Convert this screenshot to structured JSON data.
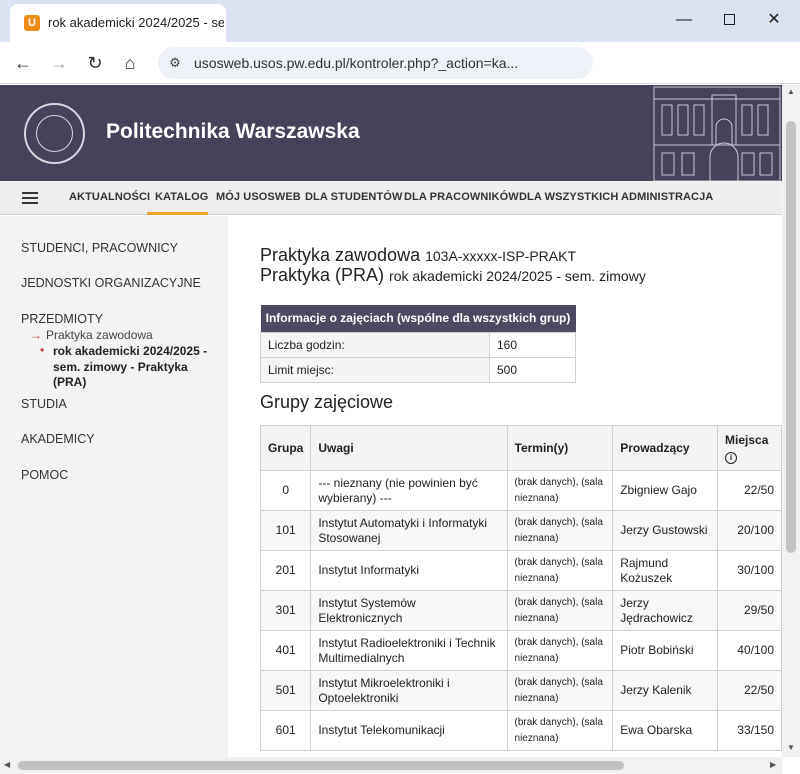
{
  "browser": {
    "tab_title": "rok akademicki 2024/2025 - sem",
    "favicon_letter": "U",
    "url": "usosweb.usos.pw.edu.pl/kontroler.php?_action=ka..."
  },
  "banner": {
    "university": "Politechnika Warszawska"
  },
  "menu": {
    "items": [
      "AKTUALNOŚCI",
      "KATALOG",
      "MÓJ USOSWEB",
      "DLA STUDENTÓW",
      "DLA PRACOWNIKÓW",
      "DLA WSZYSTKICH",
      "ADMINISTRACJA"
    ],
    "active": "KATALOG"
  },
  "sidebar": {
    "items": [
      "STUDENCI, PRACOWNICY",
      "JEDNOSTKI ORGANIZACYJNE",
      "PRZEDMIOTY",
      "STUDIA",
      "AKADEMICY",
      "POMOC"
    ],
    "sub_item": "Praktyka zawodowa",
    "current": "rok akademicki 2024/2025 - sem. zimowy - Praktyka (PRA)"
  },
  "course": {
    "name": "Praktyka zawodowa",
    "code": "103A-xxxxx-ISP-PRAKT",
    "class_type": "Praktyka (PRA)",
    "term": "rok akademicki 2024/2025 - sem. zimowy"
  },
  "info_table": {
    "header": "Informacje o zajęciach (wspólne dla wszystkich grup)",
    "rows": [
      {
        "label": "Liczba godzin:",
        "value": "160"
      },
      {
        "label": "Limit miejsc:",
        "value": "500"
      }
    ]
  },
  "groups": {
    "title": "Grupy zajęciowe",
    "columns": [
      "Grupa",
      "Uwagi",
      "Termin(y)",
      "Prowadzący",
      "Miejsca"
    ],
    "rows": [
      {
        "group": "0",
        "note": "--- nieznany (nie powinien być wybierany) ---",
        "term": "(brak danych), (sala nieznana)",
        "teacher": "Zbigniew Gajo",
        "seats": "22/50"
      },
      {
        "group": "101",
        "note": "Instytut Automatyki i Informatyki Stosowanej",
        "term": "(brak danych), (sala nieznana)",
        "teacher": "Jerzy Gustowski",
        "seats": "20/100"
      },
      {
        "group": "201",
        "note": "Instytut Informatyki",
        "term": "(brak danych), (sala nieznana)",
        "teacher": "Rajmund Kożuszek",
        "seats": "30/100"
      },
      {
        "group": "301",
        "note": "Instytut Systemów Elektronicznych",
        "term": "(brak danych), (sala nieznana)",
        "teacher": "Jerzy Jędrachowicz",
        "seats": "29/50"
      },
      {
        "group": "401",
        "note": "Instytut Radioelektroniki i Technik Multimedialnych",
        "term": "(brak danych), (sala nieznana)",
        "teacher": "Piotr Bobiński",
        "seats": "40/100"
      },
      {
        "group": "501",
        "note": "Instytut Mikroelektroniki i Optoelektroniki",
        "term": "(brak danych), (sala nieznana)",
        "teacher": "Jerzy Kalenik",
        "seats": "22/50"
      },
      {
        "group": "601",
        "note": "Instytut Telekomunikacji",
        "term": "(brak danych), (sala nieznana)",
        "teacher": "Ewa Obarska",
        "seats": "33/150"
      }
    ]
  },
  "icons": {
    "back": "arrow-left-icon",
    "forward": "arrow-right-icon",
    "reload": "reload-icon",
    "home": "home-icon",
    "site_info": "tune-icon",
    "menu": "hamburger-icon",
    "info": "info-icon"
  },
  "colors": {
    "banner": "#47425a",
    "menu_active": "#f0a030",
    "accent_red": "#c0392b",
    "favicon": "#f08a18"
  }
}
